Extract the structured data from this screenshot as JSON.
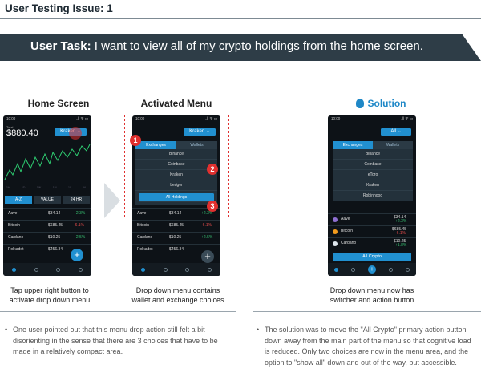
{
  "header": {
    "title": "User Testing Issue: 1",
    "task_label": "User Task:",
    "task_text": " I want to view all of my crypto holdings from the home screen."
  },
  "columns": {
    "home": {
      "title": "Home Screen",
      "caption1": "Tap upper right button to",
      "caption2": "activate drop down menu"
    },
    "menu": {
      "title": "Activated Menu",
      "caption1": "Drop down menu contains",
      "caption2": "wallet and exchange choices"
    },
    "solution": {
      "title": "Solution",
      "caption1": "Drop down menu now has",
      "caption2": "switcher and action button"
    }
  },
  "phone_common": {
    "time": "10:00",
    "status": "..ll ᯤ ▭"
  },
  "home": {
    "total_label": "Total",
    "total_value": "$880.40",
    "kraken": "Kraken",
    "sort_az": "A-Z",
    "sort_value": "VALUE",
    "sort_24h": "24 HR",
    "x_ticks": [
      "1H",
      "1D",
      "1W",
      "1M",
      "1Y",
      "ALL"
    ],
    "rows": [
      {
        "name": "Aave",
        "value": "$34.14",
        "change": "+2.3%",
        "dir": "up"
      },
      {
        "name": "Bitcoin",
        "value": "$685.45",
        "change": "-6.1%",
        "dir": "down"
      },
      {
        "name": "Cardano",
        "value": "$10.25",
        "change": "+2.5%",
        "dir": "up"
      },
      {
        "name": "Polkadot",
        "value": "$456.34",
        "change": "",
        "dir": "up"
      }
    ]
  },
  "menu": {
    "kraken": "Kraken",
    "tab_exchanges": "Exchanges",
    "tab_wallets": "Wallets",
    "items": [
      "Binance",
      "Coinbase",
      "Kraken",
      "Ledger"
    ],
    "all": "All Holdings",
    "badges": [
      "1",
      "2",
      "3"
    ],
    "rows": [
      {
        "name": "Aave",
        "value": "$34.14",
        "change": "+2.3%",
        "dir": "up"
      },
      {
        "name": "Bitcoin",
        "value": "$685.45",
        "change": "-6.1%",
        "dir": "down"
      },
      {
        "name": "Cardano",
        "value": "$10.25",
        "change": "+2.5%",
        "dir": "up"
      },
      {
        "name": "Polkadot",
        "value": "$456.34",
        "change": "",
        "dir": "up"
      }
    ]
  },
  "solution": {
    "all": "All",
    "tab_exchanges": "Exchanges",
    "tab_wallets": "Wallets",
    "items": [
      "Binance",
      "Coinbase",
      "eToro",
      "Kraken",
      "Robinhood"
    ],
    "action": "All Crypto",
    "rows": [
      {
        "name": "Aave",
        "value": "$34.14",
        "change": "+2.3%",
        "dir": "up"
      },
      {
        "name": "Bitcoin",
        "value": "$685.45",
        "change": "-6.1%",
        "dir": "down"
      },
      {
        "name": "Cardano",
        "value": "$10.25",
        "change": "+1.8%",
        "dir": "up"
      }
    ]
  },
  "notes": {
    "left": "One user pointed out that this menu drop action still felt a bit disorienting in the sense that there are 3 choices that have to be made in a relatively compact area.",
    "right": "The solution was to move the \"All Crypto\" primary action button down away from the main part of the menu so that cognitive load is reduced. Only two choices are now in the menu area, and the option to \"show all\" down and out of the way, but accessible."
  },
  "colors": {
    "accent": "#2190d0",
    "banner": "#2e3d47",
    "badge": "#e0302f",
    "solution_title": "#1f88c7"
  }
}
